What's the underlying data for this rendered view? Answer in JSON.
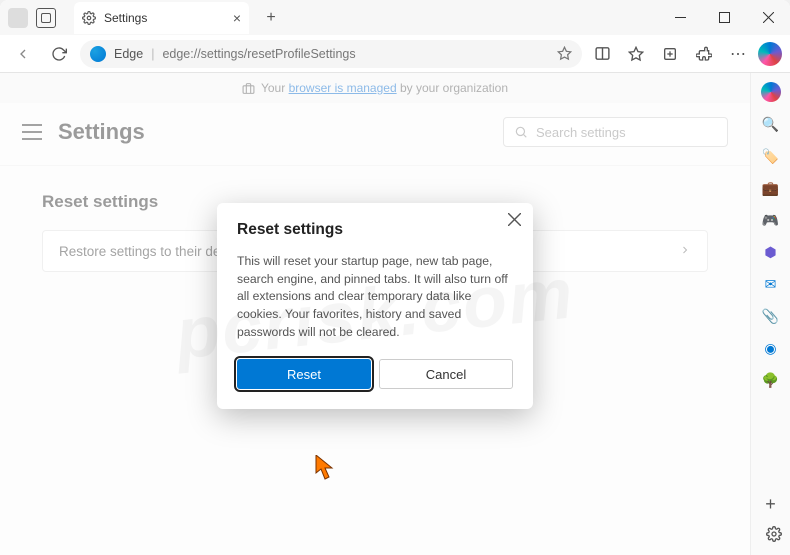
{
  "titlebar": {
    "tab_label": "Settings"
  },
  "addressbar": {
    "scheme_label": "Edge",
    "url": "edge://settings/resetProfileSettings"
  },
  "managed_banner": {
    "prefix": "Your ",
    "link_text": "browser is managed",
    "suffix": " by your organization"
  },
  "settings": {
    "page_title": "Settings",
    "search_placeholder": "Search settings",
    "section_title": "Reset settings",
    "row_label": "Restore settings to their default values"
  },
  "dialog": {
    "title": "Reset settings",
    "body": "This will reset your startup page, new tab page, search engine, and pinned tabs. It will also turn off all extensions and clear temporary data like cookies. Your favorites, history and saved passwords will not be cleared.",
    "primary": "Reset",
    "secondary": "Cancel"
  },
  "sidebar_icons": [
    {
      "name": "copilot-icon",
      "color": "",
      "glyph": ""
    },
    {
      "name": "search-sidebar-icon",
      "color": "#6b5bd1",
      "glyph": "🔍"
    },
    {
      "name": "shopping-icon",
      "color": "#0078d4",
      "glyph": "🏷️"
    },
    {
      "name": "briefcase-icon",
      "color": "#a0522d",
      "glyph": "💼"
    },
    {
      "name": "games-icon",
      "color": "#6244bb",
      "glyph": "🎮"
    },
    {
      "name": "m365-icon",
      "color": "#6b5bd1",
      "glyph": "⬢"
    },
    {
      "name": "outlook-icon",
      "color": "#0078d4",
      "glyph": "✉"
    },
    {
      "name": "drop-icon",
      "color": "#d946ef",
      "glyph": "📎"
    },
    {
      "name": "edge-side-icon",
      "color": "#0078d4",
      "glyph": "◉"
    },
    {
      "name": "tree-icon",
      "color": "#228b22",
      "glyph": "🌳"
    }
  ],
  "watermark": "pcrisk.com"
}
